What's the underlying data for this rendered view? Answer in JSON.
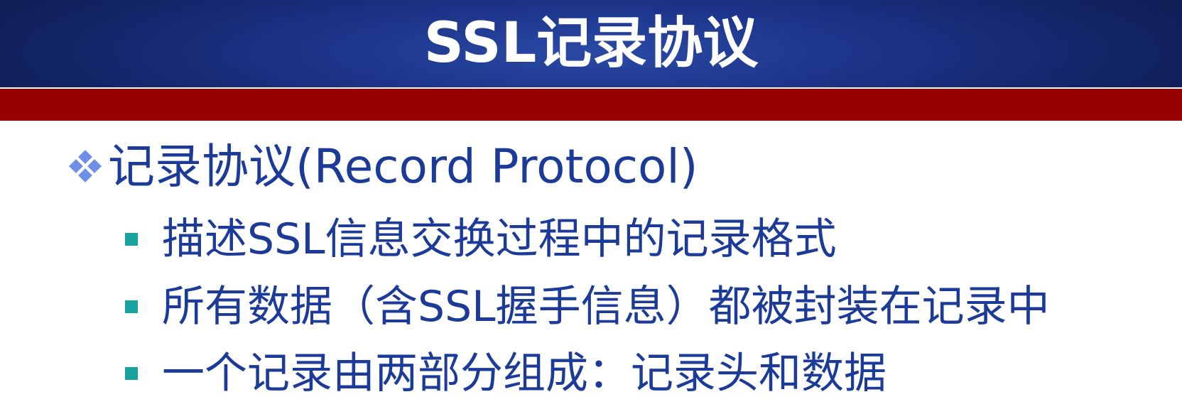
{
  "slide": {
    "title": "SSL记录协议",
    "heading": "记录协议(Record Protocol)",
    "bullets": [
      "描述SSL信息交换过程中的记录格式",
      "所有数据（含SSL握手信息）都被封装在记录中",
      "一个记录由两部分组成：记录头和数据"
    ]
  },
  "colors": {
    "title_bar": "#1c3388",
    "red_band": "#990000",
    "text": "#1c3a98",
    "diamond_bullet": "#6d8fe8",
    "square_bullet": "#16a3a0"
  },
  "icons": {
    "heading_bullet": "four-diamond-bullet-icon",
    "item_bullet": "square-bullet-icon"
  }
}
